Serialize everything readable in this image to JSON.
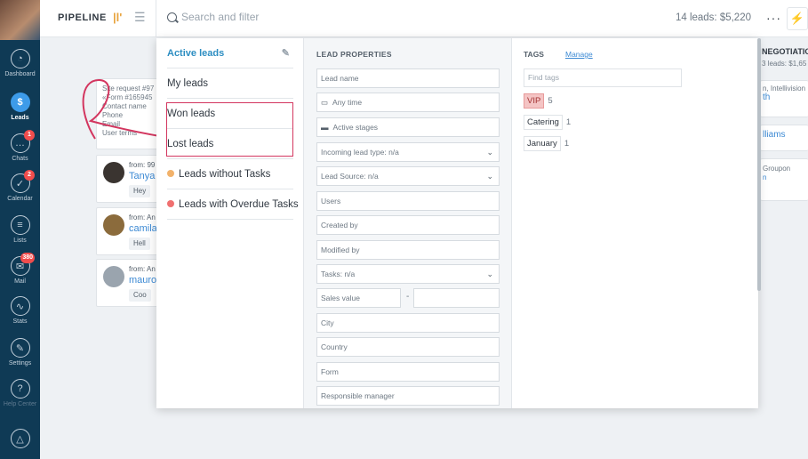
{
  "nav": {
    "items": [
      {
        "label": "Dashboard",
        "icon": "dashboard-icon",
        "glyph": "◔"
      },
      {
        "label": "Leads",
        "icon": "leads-icon",
        "glyph": "$",
        "active": true
      },
      {
        "label": "Chats",
        "icon": "chats-icon",
        "glyph": "…",
        "badge": "1"
      },
      {
        "label": "Calendar",
        "icon": "calendar-icon",
        "glyph": "✓",
        "badge": "2"
      },
      {
        "label": "Lists",
        "icon": "lists-icon",
        "glyph": "≡"
      },
      {
        "label": "Mail",
        "icon": "mail-icon",
        "glyph": "✉",
        "badge": "380"
      },
      {
        "label": "Stats",
        "icon": "stats-icon",
        "glyph": "∿"
      },
      {
        "label": "Settings",
        "icon": "settings-icon",
        "glyph": "✎"
      },
      {
        "label": "Help Center",
        "icon": "help-icon",
        "glyph": "?"
      },
      {
        "label": "",
        "icon": "bell-icon",
        "glyph": "△"
      }
    ]
  },
  "topbar": {
    "title": "PIPELINE",
    "pipe_glyph": "|l'",
    "menu_glyph": "☰",
    "search_placeholder": "Search and filter",
    "leads_total": "14 leads: $5,220",
    "more_glyph": "···",
    "bolt_glyph": "⚡"
  },
  "background": {
    "request_card": {
      "lines": [
        "Site request #97",
        "«Form #165945",
        "Contact name",
        "Phone",
        "Email",
        "User terms"
      ]
    },
    "lead_cards": [
      {
        "from": "from: 99",
        "name": "Tanya",
        "msg": "Hey"
      },
      {
        "from": "from: An",
        "name": "camila_",
        "msg": "Hell"
      },
      {
        "from": "from: An",
        "name": "mauros",
        "msg": "Coo"
      }
    ],
    "right_column": {
      "title": "NEGOTIATIO",
      "subtitle": "3 leads: $1,65",
      "snippets": [
        "n, Intellivision",
        "th",
        "lliams",
        "Groupon",
        "n"
      ]
    }
  },
  "filter": {
    "presets": [
      {
        "label": "Active leads",
        "active": true
      },
      {
        "label": "My leads"
      },
      {
        "label": "Won leads"
      },
      {
        "label": "Lost leads"
      },
      {
        "label": "Leads without Tasks",
        "dot": "#f2b26b"
      },
      {
        "label": "Leads with Overdue Tasks",
        "dot": "#f07070"
      }
    ],
    "properties": {
      "title": "LEAD PROPERTIES",
      "fields": [
        {
          "label": "Lead name"
        },
        {
          "label": "Any time",
          "prefix": "▭"
        },
        {
          "label": "Active stages",
          "prefix": "▬"
        },
        {
          "label": "Incoming lead type: n/a",
          "dropdown": true
        },
        {
          "label": "Lead Source: n/a",
          "dropdown": true
        },
        {
          "label": "Users"
        },
        {
          "label": "Created by"
        },
        {
          "label": "Modified by"
        },
        {
          "label": "Tasks: n/a",
          "dropdown": true
        },
        {
          "label": "Sales value",
          "range_sep": "-"
        },
        {
          "label": "City"
        },
        {
          "label": "Country"
        },
        {
          "label": "Form"
        },
        {
          "label": "Responsible manager"
        }
      ]
    },
    "tags": {
      "title": "TAGS",
      "manage_label": "Manage",
      "find_placeholder": "Find tags",
      "items": [
        {
          "name": "VIP",
          "count": "5",
          "style": "vip"
        },
        {
          "name": "Catering",
          "count": "1"
        },
        {
          "name": "January",
          "count": "1"
        }
      ]
    }
  },
  "colors": {
    "accent": "#2d8ec2",
    "highlight": "#d3365f",
    "nav_bg": "#0f3a55"
  }
}
